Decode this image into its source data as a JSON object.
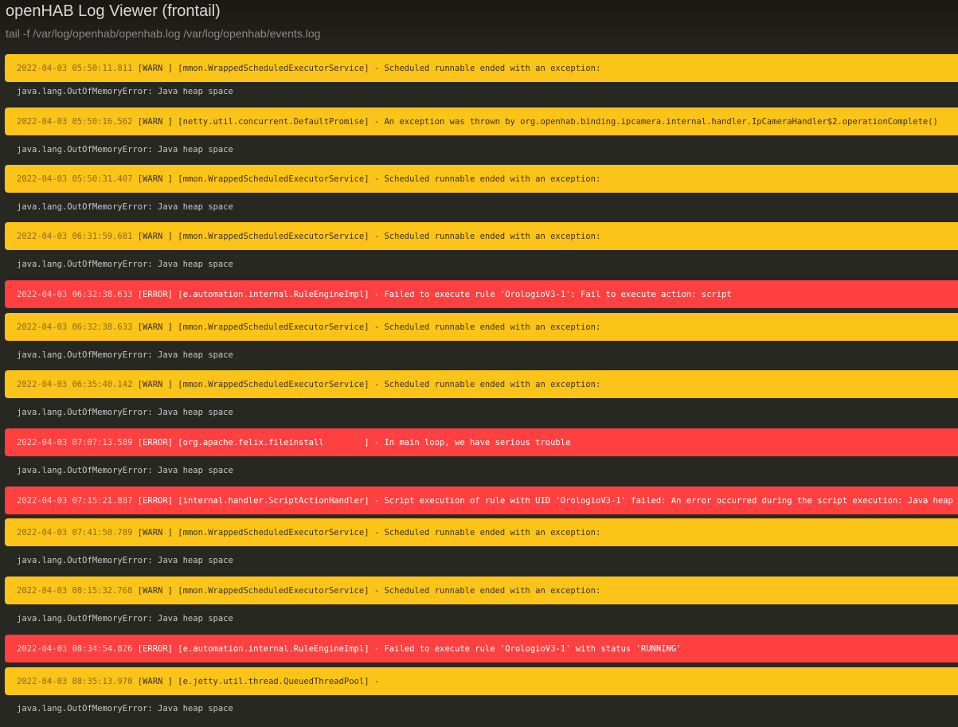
{
  "header": {
    "title": "openHAB Log Viewer (frontail)",
    "subtitle": "tail -f /var/log/openhab/openhab.log /var/log/openhab/events.log"
  },
  "colors": {
    "warn": "#fcc419",
    "error": "#ff4040",
    "background": "#272822"
  },
  "lines": [
    {
      "type": "warn",
      "timestamp": "2022-04-03 05:50:11.811",
      "text": "[WARN ] [mmon.WrappedScheduledExecutorService] - Scheduled runnable ended with an exception:"
    },
    {
      "type": "plain",
      "text": "java.lang.OutOfMemoryError: Java heap space"
    },
    {
      "type": "warn",
      "timestamp": "2022-04-03 05:50:16.562",
      "text": "[WARN ] [netty.util.concurrent.DefaultPromise] - An exception was thrown by org.openhab.binding.ipcamera.internal.handler.IpCameraHandler$2.operationComplete()"
    },
    {
      "type": "plain",
      "text": "java.lang.OutOfMemoryError: Java heap space"
    },
    {
      "type": "warn",
      "timestamp": "2022-04-03 05:50:31.407",
      "text": "[WARN ] [mmon.WrappedScheduledExecutorService] - Scheduled runnable ended with an exception:"
    },
    {
      "type": "plain",
      "text": "java.lang.OutOfMemoryError: Java heap space"
    },
    {
      "type": "warn",
      "timestamp": "2022-04-03 06:31:59.681",
      "text": "[WARN ] [mmon.WrappedScheduledExecutorService] - Scheduled runnable ended with an exception:"
    },
    {
      "type": "plain",
      "text": "java.lang.OutOfMemoryError: Java heap space"
    },
    {
      "type": "error",
      "timestamp": "2022-04-03 06:32:38.633",
      "text": "[ERROR] [e.automation.internal.RuleEngineImpl] - Failed to execute rule 'OrologioV3-1': Fail to execute action: script"
    },
    {
      "type": "warn",
      "timestamp": "2022-04-03 06:32:38.633",
      "text": "[WARN ] [mmon.WrappedScheduledExecutorService] - Scheduled runnable ended with an exception:"
    },
    {
      "type": "plain",
      "text": "java.lang.OutOfMemoryError: Java heap space"
    },
    {
      "type": "warn",
      "timestamp": "2022-04-03 06:35:40.142",
      "text": "[WARN ] [mmon.WrappedScheduledExecutorService] - Scheduled runnable ended with an exception:"
    },
    {
      "type": "plain",
      "text": "java.lang.OutOfMemoryError: Java heap space"
    },
    {
      "type": "error",
      "timestamp": "2022-04-03 07:07:13.589",
      "text": "[ERROR] [org.apache.felix.fileinstall        ] - In main loop, we have serious trouble"
    },
    {
      "type": "plain",
      "text": "java.lang.OutOfMemoryError: Java heap space"
    },
    {
      "type": "error",
      "timestamp": "2022-04-03 07:15:21.887",
      "text": "[ERROR] [internal.handler.ScriptActionHandler] - Script execution of rule with UID 'OrologioV3-1' failed: An error occurred during the script execution: Java heap space"
    },
    {
      "type": "warn",
      "timestamp": "2022-04-03 07:41:50.789",
      "text": "[WARN ] [mmon.WrappedScheduledExecutorService] - Scheduled runnable ended with an exception:"
    },
    {
      "type": "plain",
      "text": "java.lang.OutOfMemoryError: Java heap space"
    },
    {
      "type": "warn",
      "timestamp": "2022-04-03 08:15:32.768",
      "text": "[WARN ] [mmon.WrappedScheduledExecutorService] - Scheduled runnable ended with an exception:"
    },
    {
      "type": "plain",
      "text": "java.lang.OutOfMemoryError: Java heap space"
    },
    {
      "type": "error",
      "timestamp": "2022-04-03 08:34:54.826",
      "text": "[ERROR] [e.automation.internal.RuleEngineImpl] - Failed to execute rule 'OrologioV3-1' with status 'RUNNING'"
    },
    {
      "type": "warn",
      "timestamp": "2022-04-03 08:35:13.970",
      "text": "[WARN ] [e.jetty.util.thread.QueuedThreadPool] -"
    },
    {
      "type": "plain",
      "text": "java.lang.OutOfMemoryError: Java heap space"
    }
  ]
}
